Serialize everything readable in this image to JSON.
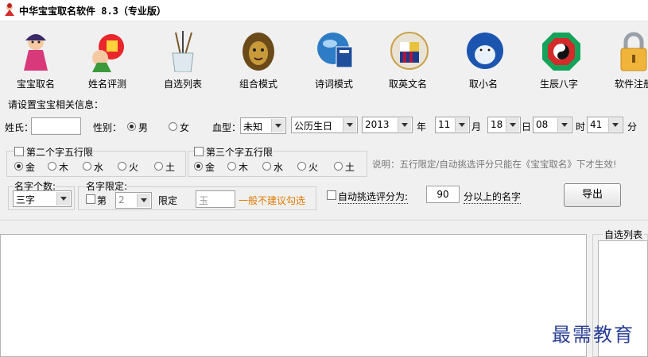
{
  "window": {
    "title": "中华宝宝取名软件 8.3（专业版）"
  },
  "toolbar": {
    "items": [
      {
        "label": "宝宝取名",
        "icon": "baby-doll-icon"
      },
      {
        "label": "姓名评测",
        "icon": "fortune-cartoon-icon"
      },
      {
        "label": "自选列表",
        "icon": "brush-pot-icon"
      },
      {
        "label": "组合模式",
        "icon": "lion-mascot-icon"
      },
      {
        "label": "诗词模式",
        "icon": "poetry-book-icon"
      },
      {
        "label": "取英文名",
        "icon": "barcelona-crest-icon"
      },
      {
        "label": "取小名",
        "icon": "blue-bird-icon"
      },
      {
        "label": "生辰八字",
        "icon": "bagua-icon"
      },
      {
        "label": "软件注册",
        "icon": "padlock-icon"
      }
    ]
  },
  "form": {
    "section_title": "请设置宝宝相关信息：",
    "surname_label": "姓氏：",
    "surname_value": "",
    "gender_label": "性别：",
    "gender_male": "男",
    "gender_female": "女",
    "blood_label": "血型：",
    "blood_value": "未知",
    "calendar_value": "公历生日",
    "year_value": "2013",
    "year_unit": "年",
    "month_value": "11",
    "month_unit": "月",
    "day_value": "18",
    "day_unit": "日",
    "hour_value": "08",
    "hour_unit": "时",
    "minute_value": "41",
    "minute_unit": "分"
  },
  "wuxing2": {
    "label": "第二个字五行限",
    "options": [
      "金",
      "木",
      "水",
      "火",
      "土"
    ]
  },
  "wuxing3": {
    "label": "第三个字五行限",
    "options": [
      "金",
      "木",
      "水",
      "火",
      "土"
    ]
  },
  "note": "说明：五行限定/自动挑选评分只能在《宝宝取名》下才生效!",
  "name_count": {
    "title": "名字个数:",
    "value": "三字"
  },
  "name_limit": {
    "title": "名字限定:",
    "check_label": "第",
    "position_value": "2",
    "limit_label": "限定",
    "char_placeholder": "玉",
    "warning": "一般不建议勾选"
  },
  "auto_score": {
    "label": "自动挑选评分为:",
    "value": "90",
    "suffix": "分以上的名字"
  },
  "export_button": "导出",
  "side_panel": {
    "title": "自选列表"
  },
  "watermark": "最需教育",
  "colors": {
    "warning": "#e07a00",
    "watermark": "#2a3f97",
    "note": "#777777"
  }
}
